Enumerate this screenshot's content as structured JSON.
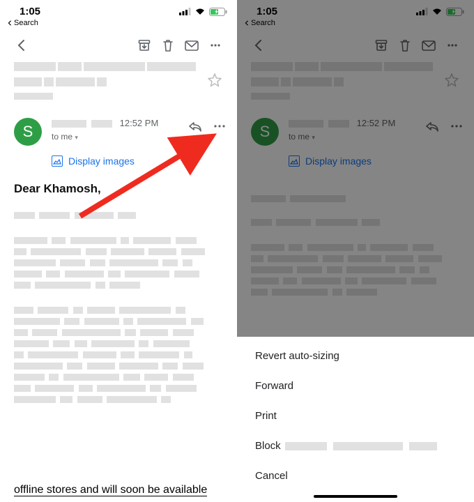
{
  "status": {
    "time": "1:05",
    "back_label": "Search"
  },
  "sender": {
    "avatar_initial": "S",
    "time": "12:52 PM",
    "to_line": "to me",
    "display_images": "Display images"
  },
  "greeting": "Dear Khamosh,",
  "end_text": "offline stores and will soon be available",
  "sheet": {
    "items": {
      "revert": "Revert auto-sizing",
      "forward": "Forward",
      "print": "Print",
      "block": "Block",
      "cancel": "Cancel"
    }
  }
}
